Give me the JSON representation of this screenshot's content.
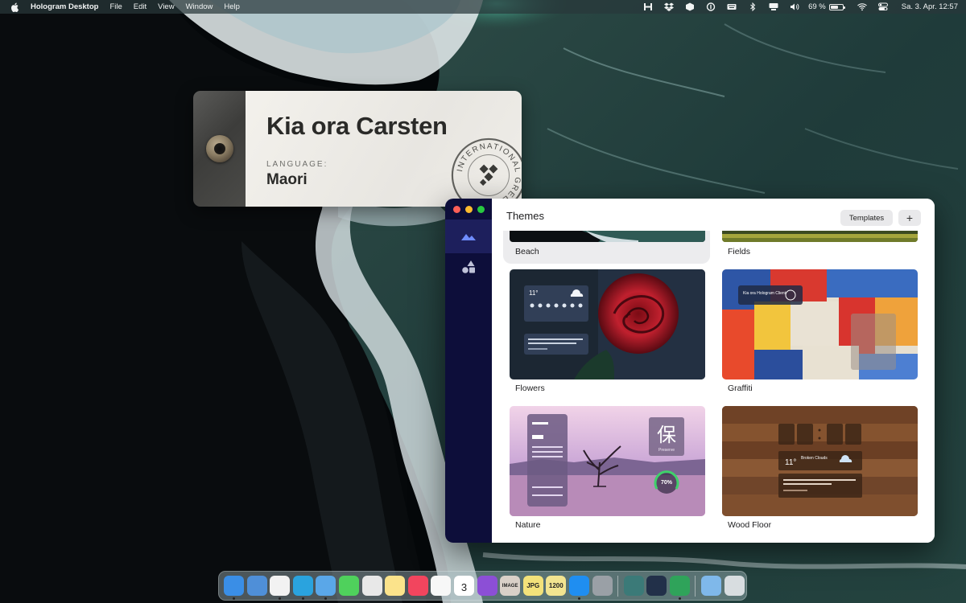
{
  "menubar": {
    "app_name": "Hologram Desktop",
    "menus": [
      "File",
      "Edit",
      "View",
      "Window",
      "Help"
    ],
    "battery_percent": "69 %",
    "battery_level": 0.69,
    "clock": "Sa. 3. Apr.  12:57",
    "status_icons": [
      "hologram-icon",
      "dropbox-icon",
      "cube-icon",
      "onepassword-icon",
      "keyboard-icon",
      "bluetooth-icon",
      "display-icon",
      "volume-icon",
      "wifi-icon",
      "control-center-icon"
    ]
  },
  "greeting": {
    "text": "Kia ora Carsten",
    "language_label": "LANGUAGE:",
    "language": "Maori",
    "stamp_text": "INTERNATIONAL GREETING"
  },
  "themes_window": {
    "title": "Themes",
    "templates_button": "Templates",
    "add_button": "+",
    "sidebar": [
      {
        "icon": "mountains-icon",
        "active": true
      },
      {
        "icon": "shapes-icon",
        "active": false
      }
    ],
    "themes": [
      {
        "name": "Beach",
        "selected": true
      },
      {
        "name": "Fields",
        "selected": false
      },
      {
        "name": "Flowers",
        "selected": false
      },
      {
        "name": "Graffiti",
        "selected": false
      },
      {
        "name": "Nature",
        "selected": false
      },
      {
        "name": "Wood Floor",
        "selected": false
      }
    ],
    "nature_preview": {
      "kanji": "保",
      "kanji_caption": "Preserve",
      "gauge": "70%"
    },
    "wood_preview": {
      "temperature": "11°",
      "condition": "Broken Clouds",
      "quote": "\"The weak can never forgive. Forgiveness is the attribute of the strong.\""
    },
    "flowers_preview": {
      "temperature": "11°",
      "quote": "\"When life hands us a lemon, ask for a lemon lemonade.\""
    },
    "graffiti_preview": {
      "greeting": "Kia ora Hologram Client"
    }
  },
  "dock": {
    "apps": [
      {
        "name": "finder-icon",
        "color": "#3a8ee6",
        "label": "",
        "running": true
      },
      {
        "name": "window-icon",
        "color": "#4f8fd8",
        "label": "",
        "running": false
      },
      {
        "name": "chrome-icon",
        "color": "#f2f2f2",
        "label": "",
        "running": true
      },
      {
        "name": "telegram-icon",
        "color": "#2aa3de",
        "label": "",
        "running": true
      },
      {
        "name": "tweetbot-icon",
        "color": "#5aa7e8",
        "label": "",
        "running": true
      },
      {
        "name": "messages-icon",
        "color": "#4fd15c",
        "label": "",
        "running": false
      },
      {
        "name": "cloud-upload-icon",
        "color": "#e8e8e8",
        "label": "",
        "running": false
      },
      {
        "name": "notes-icon",
        "color": "#fbe38b",
        "label": "",
        "running": false
      },
      {
        "name": "music-icon",
        "color": "#f2455e",
        "label": "",
        "running": false
      },
      {
        "name": "photos-icon",
        "color": "#f7f7f7",
        "label": "",
        "running": false
      },
      {
        "name": "calendar-icon",
        "color": "#ffffff",
        "label": "3",
        "running": false
      },
      {
        "name": "affinity-icon",
        "color": "#8c4fd6",
        "label": "",
        "running": false
      },
      {
        "name": "image-tool-icon",
        "color": "#d9d0c8",
        "label": "IMAGE",
        "running": false
      },
      {
        "name": "jpg-icon",
        "color": "#f3e27a",
        "label": "JPG",
        "running": false
      },
      {
        "name": "resize-1200-icon",
        "color": "#f2e490",
        "label": "1200",
        "running": false
      },
      {
        "name": "app-store-icon",
        "color": "#1f8ef1",
        "label": "",
        "running": true
      },
      {
        "name": "system-preferences-icon",
        "color": "#9aa0a6",
        "label": "",
        "running": false
      },
      {
        "name": "brain-icon",
        "color": "#3b7a78",
        "label": "",
        "running": false
      },
      {
        "name": "prompt-icon",
        "color": "#223049",
        "label": "",
        "running": false
      },
      {
        "name": "hologram-app-icon",
        "color": "#2fa35a",
        "label": "",
        "running": true
      },
      {
        "name": "applications-folder-icon",
        "color": "#7fb8ea",
        "label": "",
        "running": false
      },
      {
        "name": "trash-icon",
        "color": "#d8dde0",
        "label": "",
        "running": false
      }
    ]
  }
}
